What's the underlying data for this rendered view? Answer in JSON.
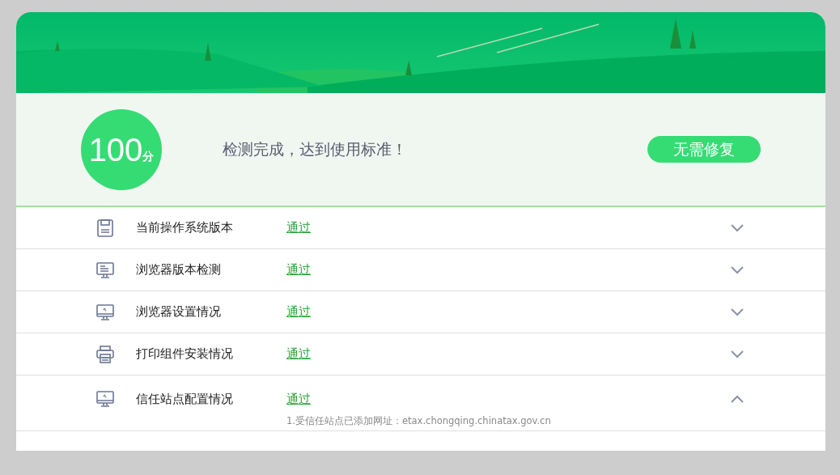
{
  "summary": {
    "score": "100",
    "unit": "分",
    "message": "检测完成，达到使用标准！",
    "action": "无需修复"
  },
  "checks": [
    {
      "kind": "floppy",
      "name": "当前操作系统版本",
      "status": "通过",
      "expanded": false
    },
    {
      "kind": "screen",
      "name": "浏览器版本检测",
      "status": "通过",
      "expanded": false
    },
    {
      "kind": "monitor",
      "name": "浏览器设置情况",
      "status": "通过",
      "expanded": false
    },
    {
      "kind": "printer",
      "name": "打印组件安装情况",
      "status": "通过",
      "expanded": false
    },
    {
      "kind": "monitor",
      "name": "信任站点配置情况",
      "status": "通过",
      "expanded": true,
      "details": [
        "1.受信任站点已添加网址：etax.chongqing.chinatax.gov.cn"
      ]
    }
  ]
}
